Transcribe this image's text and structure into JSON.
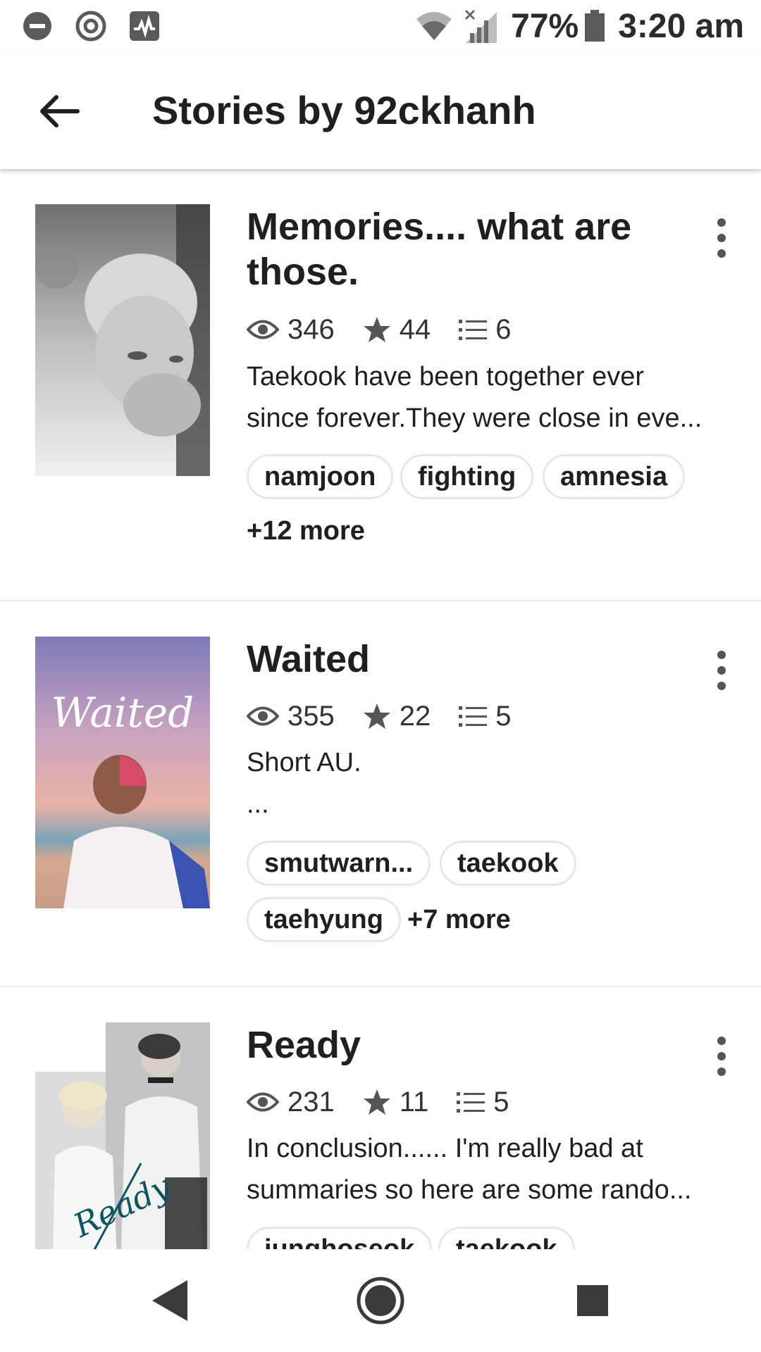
{
  "status_bar": {
    "left_icons": [
      "do-not-disturb-icon",
      "target-icon",
      "activity-monitor-icon"
    ],
    "right_icons": [
      "wifi-icon",
      "no-signal-icon",
      "battery-icon"
    ],
    "battery": "77%",
    "time": "3:20 am"
  },
  "appbar": {
    "back_icon": "back-arrow-icon",
    "title": "Stories by 92ckhanh"
  },
  "stories": [
    {
      "title_lines": [
        "Memories.... what are",
        "those."
      ],
      "reads": "346",
      "votes": "44",
      "parts": "6",
      "description_lines": [
        "Taekook have been together ever",
        "since forever.They were close in eve..."
      ],
      "tags": [
        "namjoon",
        "fighting",
        "amnesia"
      ],
      "more_tags": "+12 more",
      "cover_icon": "grayscale-portrait-cover"
    },
    {
      "title_lines": [
        "Waited"
      ],
      "reads": "355",
      "votes": "22",
      "parts": "5",
      "description_lines": [
        "Short AU.",
        "..."
      ],
      "tags": [
        "smutwarn...",
        "taekook",
        "taehyung"
      ],
      "more_tags": "+7 more",
      "cover_text": "Waited",
      "cover_icon": "beach-sky-cover"
    },
    {
      "title_lines": [
        "Ready"
      ],
      "reads": "231",
      "votes": "11",
      "parts": "5",
      "description_lines": [
        "In conclusion...... I'm really bad at",
        "summaries so here are some rando..."
      ],
      "tags": [
        "junghoseok",
        "taekook"
      ],
      "cover_text": "Ready",
      "cover_icon": "two-people-cover"
    }
  ],
  "navbar": {
    "icons": [
      "nav-back-icon",
      "nav-home-icon",
      "nav-recents-icon"
    ]
  },
  "colors": {
    "text": "#1f1f1f",
    "icon_gray": "#555555",
    "divider": "#ececec",
    "tag_border": "#e7e7e7"
  }
}
